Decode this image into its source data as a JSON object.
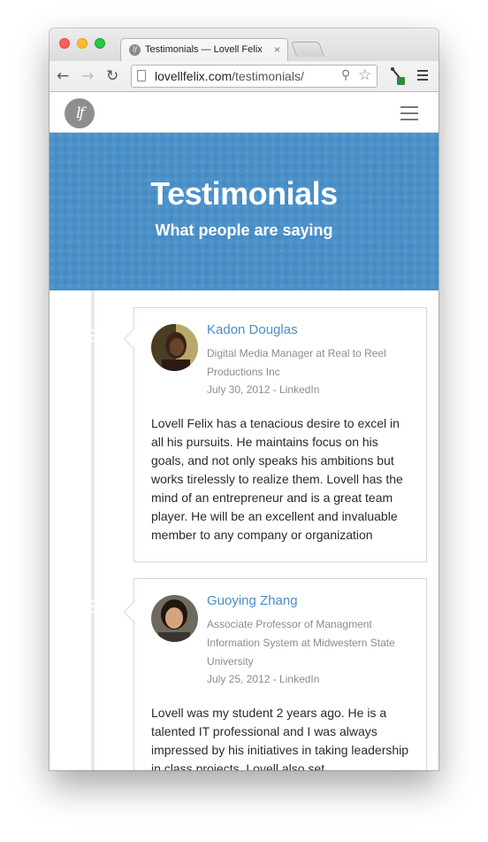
{
  "browser": {
    "tab_title": "Testimonials — Lovell Felix",
    "tab_favicon_text": "lf",
    "tab_close": "×",
    "url_host": "lovellfelix.com",
    "url_path": "/testimonials/",
    "icons": [
      "back-icon",
      "forward-icon",
      "reload-icon",
      "page-icon",
      "zoom-icon",
      "star-icon",
      "eyedropper-icon",
      "menu-icon"
    ]
  },
  "site": {
    "logo_text": "lf"
  },
  "hero": {
    "title": "Testimonials",
    "subtitle": "What people are saying",
    "color": "#4a90c9"
  },
  "testimonials": [
    {
      "name": "Kadon Douglas",
      "role": "Digital Media Manager at Real to Reel Productions Inc",
      "date": "July 30, 2012 - LinkedIn",
      "quote": "Lovell Felix has a tenacious desire to excel in all his pursuits. He maintains focus on his goals, and not only speaks his ambitions but works tirelessly to realize them. Lovell has the mind of an entrepreneur and is a great team player. He will be an excellent and invaluable member to any company or organization"
    },
    {
      "name": "Guoying Zhang",
      "role": "Associate Professor of Managment Information System at Midwestern State University",
      "date": "July 25, 2012 - LinkedIn",
      "quote": "Lovell was my student 2 years ago. He is a talented IT professional and I was always impressed by his initiatives in taking leadership in class projects. Lovell also set"
    }
  ],
  "colors": {
    "link": "#4a8ec6",
    "muted": "#8c8c8c"
  }
}
